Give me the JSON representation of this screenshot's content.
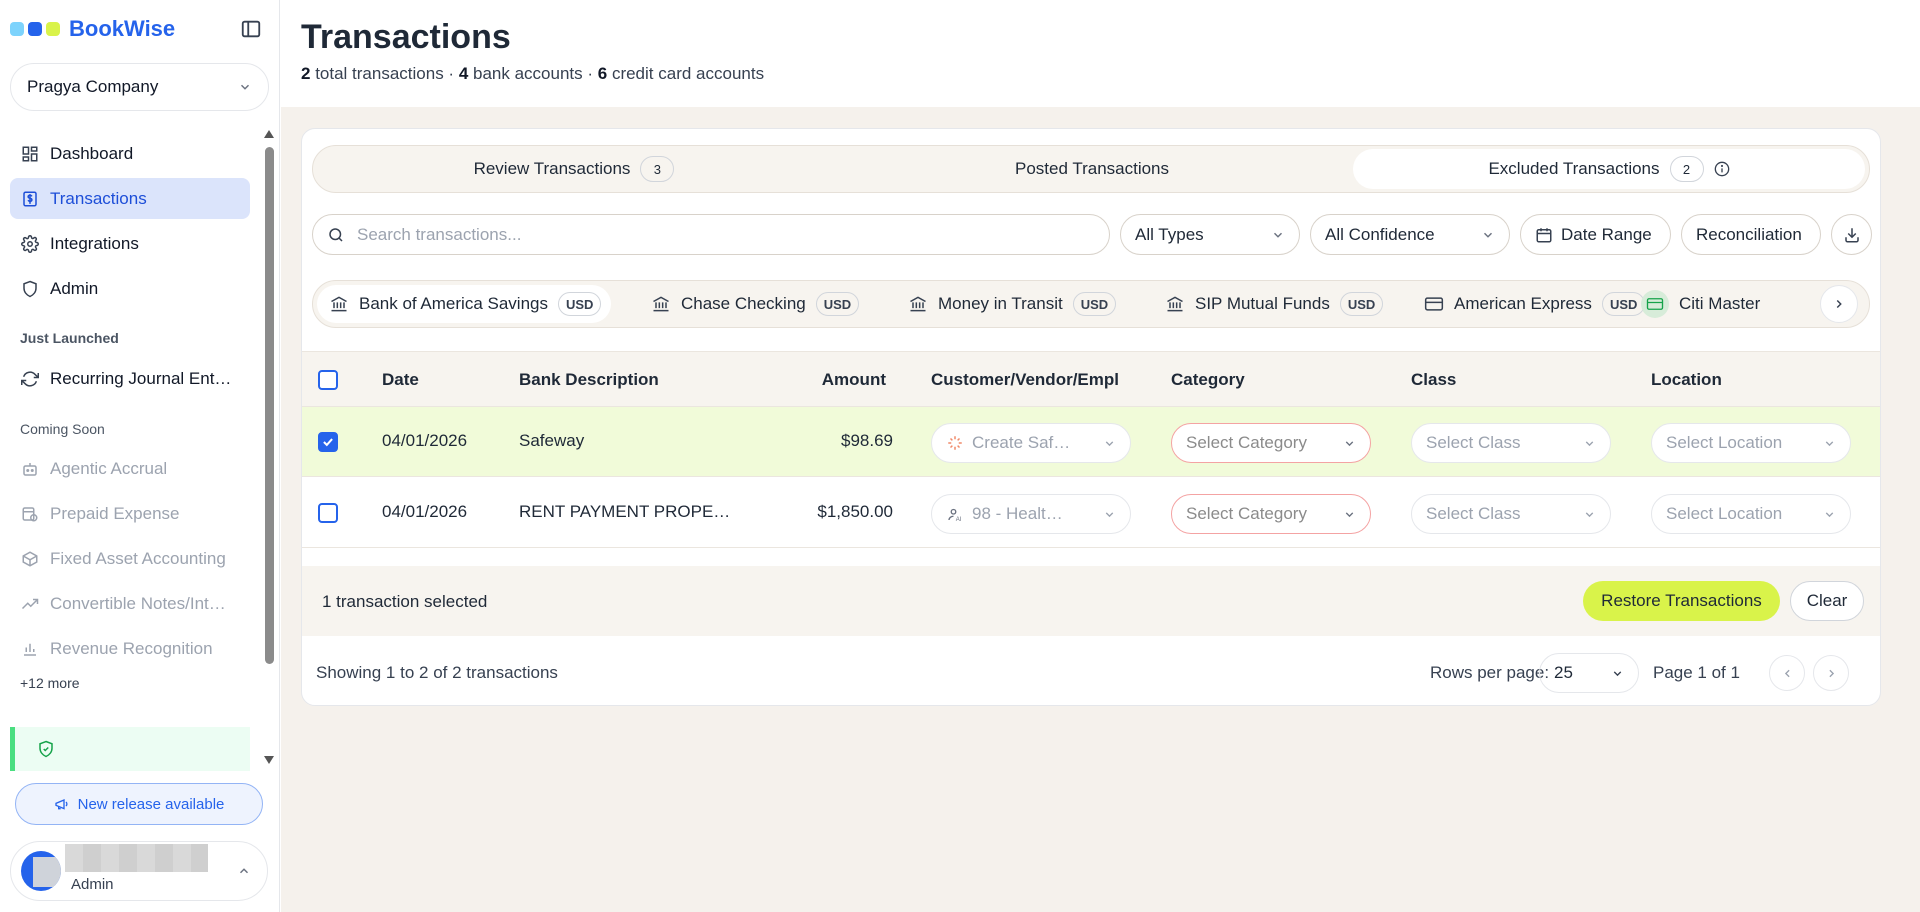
{
  "app": {
    "name": "BookWise",
    "logo_colors": [
      "#7dd3fc",
      "#2563eb",
      "#d9f34a"
    ]
  },
  "sidebar": {
    "company": "Pragya Company",
    "nav": [
      {
        "label": "Dashboard",
        "icon": "dashboard-icon"
      },
      {
        "label": "Transactions",
        "icon": "dollar-doc-icon",
        "active": true
      },
      {
        "label": "Integrations",
        "icon": "gear-icon"
      },
      {
        "label": "Admin",
        "icon": "shield-icon"
      }
    ],
    "just_launched_label": "Just Launched",
    "just_launched": [
      {
        "label": "Recurring Journal Ent…",
        "icon": "refresh-icon"
      }
    ],
    "coming_soon_label": "Coming Soon",
    "coming_soon": [
      {
        "label": "Agentic Accrual",
        "icon": "robot-icon"
      },
      {
        "label": "Prepaid Expense",
        "icon": "calendar-clock-icon"
      },
      {
        "label": "Fixed Asset Accounting",
        "icon": "box-icon"
      },
      {
        "label": "Convertible Notes/Int…",
        "icon": "trend-up-icon"
      },
      {
        "label": "Revenue Recognition",
        "icon": "bar-chart-icon"
      }
    ],
    "more_link": "+12 more",
    "release_button": "New release available",
    "user_role": "Admin"
  },
  "header": {
    "title": "Transactions",
    "summary": {
      "total_count": "2",
      "total_text": " total transactions · ",
      "bank_count": "4",
      "bank_text": " bank accounts · ",
      "card_count": "6",
      "card_text": " credit card accounts"
    }
  },
  "tabs": [
    {
      "label": "Review Transactions",
      "count": "3"
    },
    {
      "label": "Posted Transactions"
    },
    {
      "label": "Excluded Transactions",
      "count": "2",
      "active": true
    }
  ],
  "filters": {
    "search_placeholder": "Search transactions...",
    "type": "All Types",
    "confidence": "All Confidence",
    "date_range": "Date Range",
    "reconciliation": "Reconciliation"
  },
  "accounts": [
    {
      "name": "Bank of America Savings",
      "currency": "USD",
      "icon": "bank-icon",
      "active": true
    },
    {
      "name": "Chase Checking",
      "currency": "USD",
      "icon": "bank-icon"
    },
    {
      "name": "Money in Transit",
      "currency": "USD",
      "icon": "bank-icon"
    },
    {
      "name": "SIP Mutual Funds",
      "currency": "USD",
      "icon": "bank-icon"
    },
    {
      "name": "American Express",
      "currency": "USD",
      "icon": "credit-card-icon"
    },
    {
      "name": "Citi Master",
      "icon": "credit-card-icon"
    }
  ],
  "table": {
    "columns": [
      "Date",
      "Bank Description",
      "Amount",
      "Customer/Vendor/Empl",
      "Category",
      "Class",
      "Location"
    ],
    "rows": [
      {
        "selected": true,
        "date": "04/01/2026",
        "description": "Safeway",
        "amount": "$98.69",
        "vendor": "Create Saf…",
        "vendor_icon": "sparkle-icon",
        "category": "Select Category",
        "class": "Select Class",
        "location": "Select Location"
      },
      {
        "selected": false,
        "date": "04/01/2026",
        "description": "RENT PAYMENT PROPE…",
        "amount": "$1,850.00",
        "vendor": "98 - Healt…",
        "vendor_icon": "ai-person-icon",
        "category": "Select Category",
        "class": "Select Class",
        "location": "Select Location"
      }
    ]
  },
  "bulk": {
    "selected_text": "1 transaction selected",
    "restore_label": "Restore Transactions",
    "clear_label": "Clear"
  },
  "pagination": {
    "showing": "Showing 1 to 2 of 2 transactions",
    "rows_per_page_label": "Rows per page:",
    "rows_per_page": "25",
    "page_text": "Page 1 of 1"
  }
}
